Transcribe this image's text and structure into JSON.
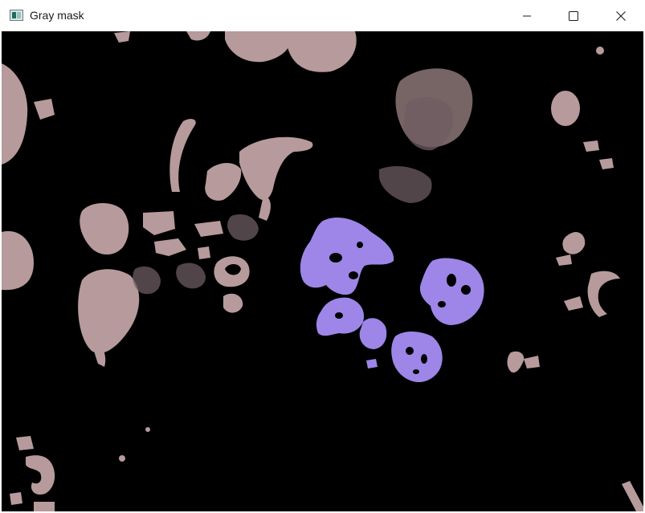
{
  "window": {
    "title": "Gray mask",
    "controls": {
      "minimize_icon": "minimize-icon",
      "maximize_icon": "maximize-icon",
      "close_icon": "close-icon"
    }
  },
  "image": {
    "background_color": "#000000",
    "colors": {
      "pink_regions": "#b79a9b",
      "purple_regions": "#9d86e8"
    }
  }
}
